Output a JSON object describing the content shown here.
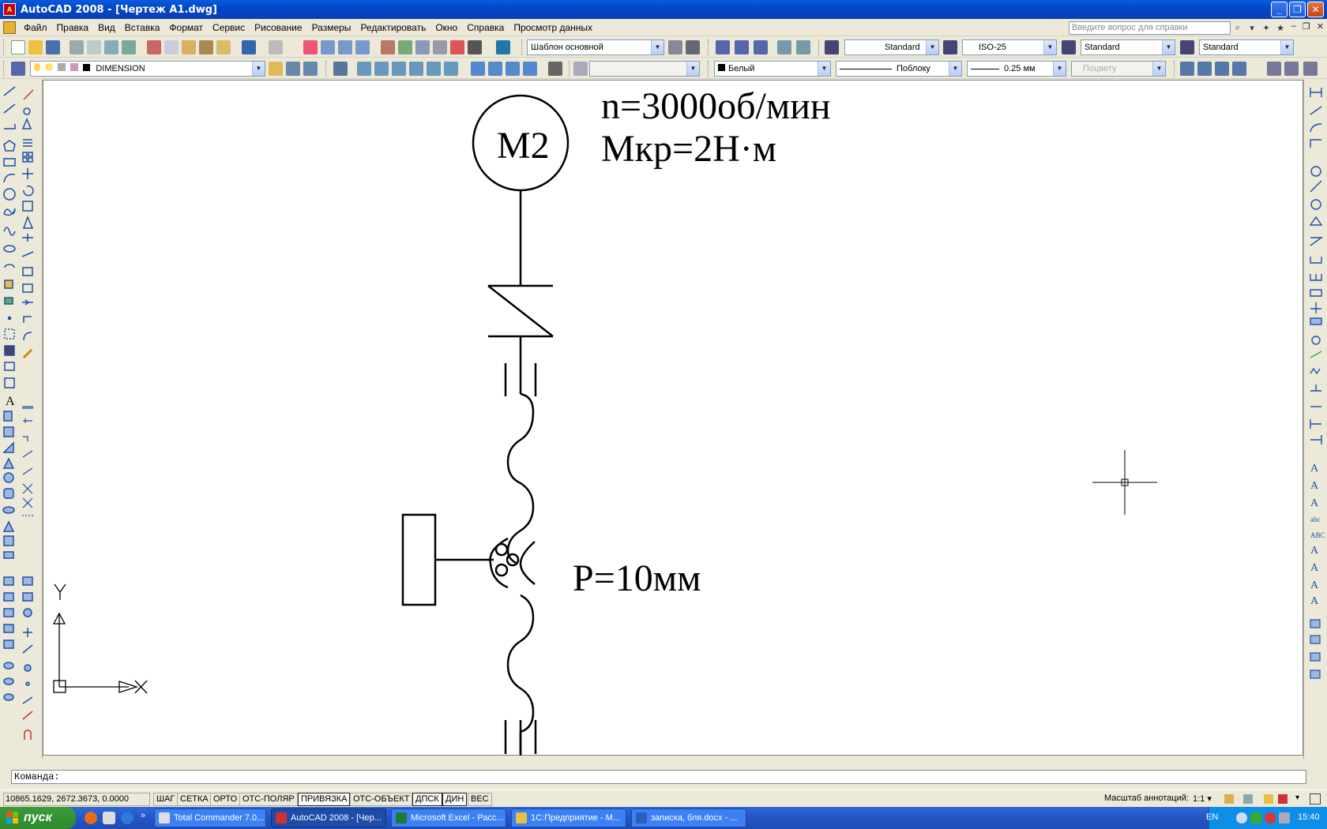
{
  "window": {
    "title": "AutoCAD 2008 - [Чертеж А1.dwg]"
  },
  "menu": [
    "Файл",
    "Правка",
    "Вид",
    "Вставка",
    "Формат",
    "Сервис",
    "Рисование",
    "Размеры",
    "Редактировать",
    "Окно",
    "Справка",
    "Просмотр данных"
  ],
  "help_search": {
    "placeholder": "Введите вопрос для справки"
  },
  "toolbar1": {
    "workspace": "Шаблон основной",
    "text_style": "Standard",
    "dim_style": "ISO-25",
    "table_style": "Standard",
    "mleader_style": "Standard"
  },
  "toolbar2": {
    "layer": "DIMENSION",
    "color": "Белый",
    "linetype": "Поблоку",
    "lineweight": "0.25 мм",
    "plotstyle": "Поцвету"
  },
  "drawing": {
    "motor_label": "M2",
    "speed_text": "n=3000об/мин",
    "torque_text": "Мкр=2Н·м",
    "pitch_text": "P=10мм",
    "ucs_y": "Y",
    "ucs_x": "X"
  },
  "command": {
    "prompt": "Команда:"
  },
  "status": {
    "coords": "10865.1629, 2672.3673, 0.0000",
    "buttons": [
      "ШАГ",
      "СЕТКА",
      "ОРТО",
      "ОТС-ПОЛЯР",
      "ПРИВЯЗКА",
      "ОТС-ОБЪЕКТ",
      "ДПСК",
      "ДИН",
      "ВЕС"
    ],
    "annotation_label": "Масштаб аннотаций:",
    "annotation_value": "1:1"
  },
  "taskbar": {
    "start": "пуск",
    "tasks": [
      "Total Commander 7.0...",
      "AutoCAD 2008 - [Чер...",
      "Microsoft Excel - Расс...",
      "1С:Предприятие - М...",
      "записка, бля.docx - ..."
    ],
    "lang": "EN",
    "clock": "15:40"
  }
}
